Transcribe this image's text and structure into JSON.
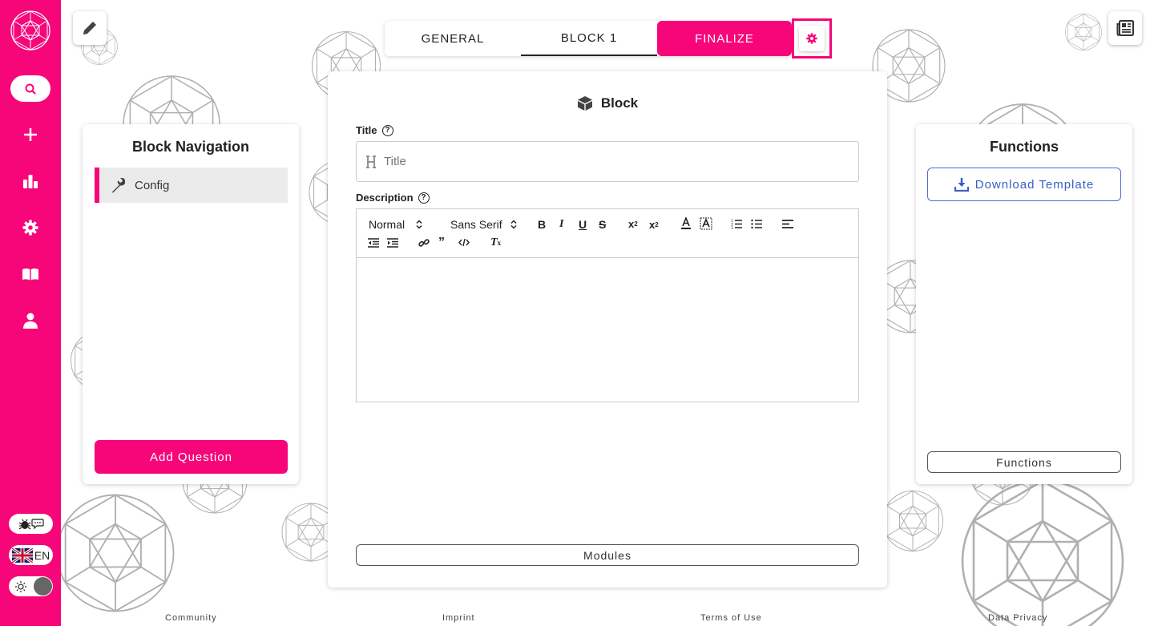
{
  "colors": {
    "accent": "#f7067a",
    "link_blue": "#3a5ec6"
  },
  "sidebar": {
    "icons": [
      "search-icon",
      "plus-icon",
      "bar-chart-icon",
      "settings-icon",
      "book-icon",
      "user-icon"
    ],
    "language": "EN"
  },
  "tabs": [
    {
      "label": "GENERAL",
      "state": "default"
    },
    {
      "label": "BLOCK 1",
      "state": "active"
    },
    {
      "label": "FINALIZE",
      "state": "highlighted"
    }
  ],
  "left_panel": {
    "title": "Block Navigation",
    "items": [
      {
        "label": "Config",
        "icon": "wrench-icon"
      }
    ],
    "add_button": "Add Question"
  },
  "center_panel": {
    "title": "Block",
    "title_field": {
      "label": "Title",
      "placeholder": "Title",
      "value": ""
    },
    "description_field": {
      "label": "Description"
    },
    "toolbar": {
      "heading_select": "Normal",
      "font_select": "Sans Serif"
    },
    "modules_button": "Modules"
  },
  "right_panel": {
    "title": "Functions",
    "download_button": "Download Template",
    "functions_button": "Functions"
  },
  "footer": {
    "links": [
      "Community",
      "Imprint",
      "Terms of Use",
      "Data Privacy"
    ]
  }
}
